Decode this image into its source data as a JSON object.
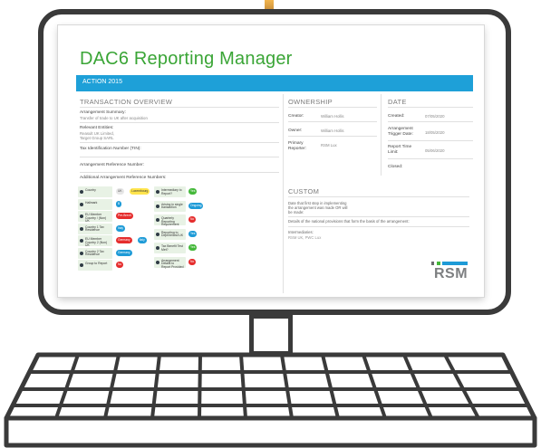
{
  "app": {
    "title": "DAC6 Reporting Manager",
    "bar_text": "ACTION 2015",
    "accent": "#1ea0d8",
    "title_color": "#3aa536"
  },
  "transaction": {
    "heading": "TRANSACTION OVERVIEW",
    "summary_label": "Arrangement Summary:",
    "summary_value": "Transfer of trade to UK after acquisition",
    "entities_label": "Relevant Entities:",
    "entities_values": [
      "Reasult UK Limited,",
      "Target Group SARL"
    ],
    "tin_label": "Tax Identification Number (TIN):",
    "ref_label": "Arrangement Reference Number:",
    "add_ref_label": "Additional Arrangement Reference Numbers:"
  },
  "ownership": {
    "heading": "OWNERSHIP",
    "creator_label": "Creator:",
    "creator_value": "William Hollis",
    "owner_label": "Owner:",
    "owner_value": "William Hollis",
    "reporter_label": "Primary Reporter:",
    "reporter_value": "RSM Lux"
  },
  "date": {
    "heading": "DATE",
    "created_label": "Created:",
    "created_value": "07/05/2020",
    "trigger_label": "Arrangement Trigger Date:",
    "trigger_value": "18/05/2020",
    "report_label": "Report Time Limit:",
    "report_value": "05/06/2020",
    "closed_label": "Closed:"
  },
  "custom": {
    "heading": "CUSTOM",
    "line1": "Date that first step in implementing",
    "line2": "the arrangement was made OR will",
    "line3": "be made:",
    "details": "Details of the national provisions that form the basis of the arrangement:",
    "intermediaries_label": "Intermediaries:",
    "intermediaries_value": "RSM UK, PWC Lux"
  },
  "diagram": {
    "left": [
      {
        "label": "Country",
        "pills": [
          {
            "text": "UK",
            "color": "grey"
          },
          {
            "text": "Luxembourg",
            "color": "yellow"
          }
        ]
      },
      {
        "label": "Hallmark",
        "pills": [
          {
            "text": "B",
            "color": "blue"
          }
        ]
      },
      {
        "label": "EU Member Country / (Non) UK",
        "pills": [
          {
            "text": "Pre-Brexit",
            "color": "red"
          }
        ]
      },
      {
        "label": "Country 1 Tax Residence",
        "pills": [
          {
            "text": "Italy",
            "color": "blue"
          }
        ]
      },
      {
        "label": "EU Member Country 2 (Non) UK",
        "pills": [
          {
            "text": "Germany",
            "color": "red"
          },
          {
            "text": "Italy",
            "color": "blue"
          }
        ]
      },
      {
        "label": "Country 2 Tax Residence",
        "pills": [
          {
            "text": "Germany",
            "color": "blue"
          }
        ]
      },
      {
        "label": "Group to Report",
        "pills": [
          {
            "text": "No",
            "color": "red"
          }
        ]
      }
    ],
    "right": [
      {
        "label": "Intermediary to Report?",
        "pills": [
          {
            "text": "Yes",
            "color": "green"
          }
        ]
      },
      {
        "label": "Arising in single transaction",
        "pills": [
          {
            "text": "Ongoing",
            "color": "blue"
          }
        ]
      },
      {
        "label": "Quarterly Reporting Requirement",
        "pills": [
          {
            "text": "No",
            "color": "red"
          }
        ]
      },
      {
        "label": "Reporting to Dept/Ireland UK",
        "pills": [
          {
            "text": "Yes",
            "color": "blue"
          }
        ]
      },
      {
        "label": "Tax Benefit Test Met?",
        "pills": [
          {
            "text": "Yes",
            "color": "green"
          }
        ]
      },
      {
        "label": "Arrangement Details to Report Provided",
        "pills": [
          {
            "text": "No",
            "color": "red"
          }
        ]
      }
    ]
  },
  "brand": {
    "logo": "RSM"
  }
}
